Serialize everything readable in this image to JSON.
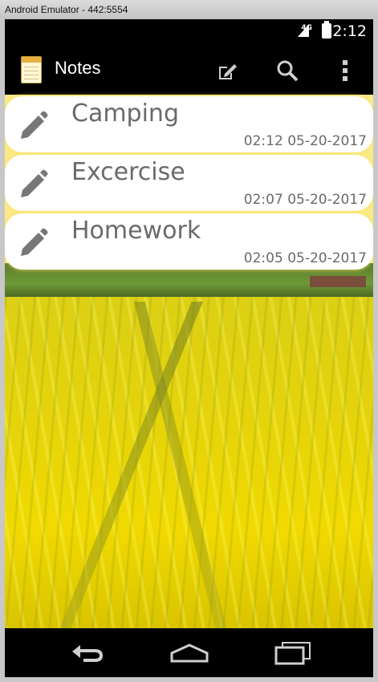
{
  "window": {
    "title": "Android Emulator - 442:5554"
  },
  "status_bar": {
    "network": "4G",
    "time": "2:12"
  },
  "action_bar": {
    "title": "Notes",
    "actions": {
      "new_note": "compose-icon",
      "search": "search-icon",
      "overflow": "overflow-menu-icon"
    }
  },
  "notes": [
    {
      "title": "Camping",
      "date": "02:12 05-20-2017",
      "icon": "pencil-icon"
    },
    {
      "title": "Excercise",
      "date": "02:07 05-20-2017",
      "icon": "pencil-icon"
    },
    {
      "title": "Homework",
      "date": "02:05 05-20-2017",
      "icon": "pencil-icon"
    }
  ],
  "nav_bar": {
    "back": "back-icon",
    "home": "home-icon",
    "recents": "recent-apps-icon"
  },
  "colors": {
    "card": "#ffffff",
    "text": "#6a6a6a",
    "field": "#e6d40a"
  }
}
